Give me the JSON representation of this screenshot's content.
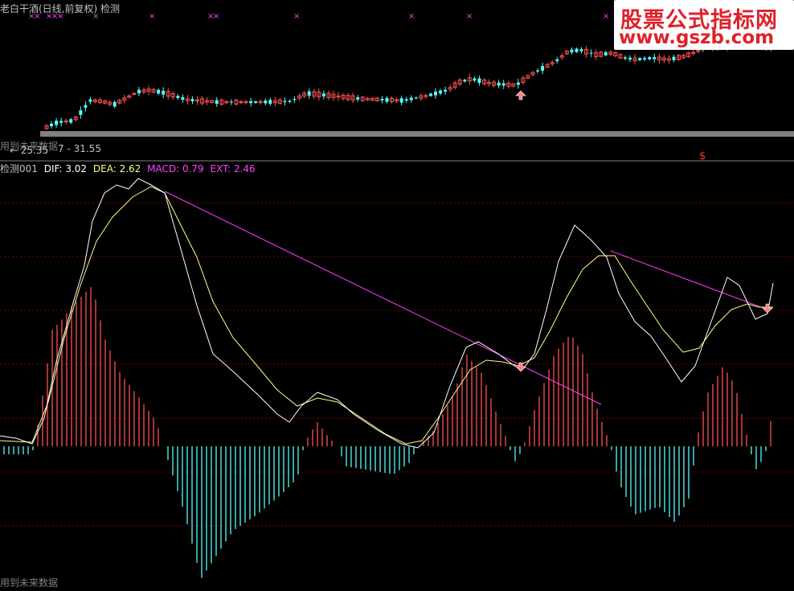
{
  "upper_panel": {
    "title": "老白干酒(日线,前复权)",
    "indicator": "检测",
    "future_label": "用到未来数据",
    "range_left": "← 25.35",
    "range_right": "7 - 31.55",
    "top_marks": "×",
    "up_signal": "⇧"
  },
  "lower_panel": {
    "indicator": "检测001",
    "dif_label": "DIF: 3.02",
    "dea_label": "DEA: 2.62",
    "macd_label": "MACD: 0.79",
    "ext_label": "EXT: 2.46",
    "future_label": "用到未来数据",
    "dollar_mark": "$"
  },
  "watermark": {
    "line1": "股票公式指标网",
    "line2": "www.gszb.com"
  },
  "colors": {
    "up": "#ff5050",
    "down": "#54fcfc",
    "dif": "#ffffff",
    "dea": "#ffff88",
    "trend": "#ff40ff",
    "grid": "#800000",
    "bar_pos": "#ff5050",
    "bar_neg": "#54fcfc"
  }
}
